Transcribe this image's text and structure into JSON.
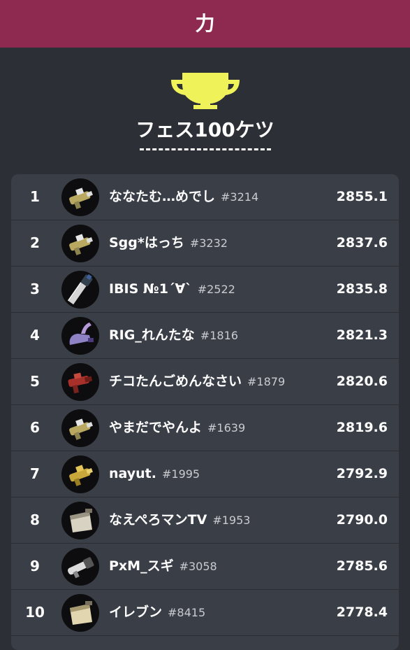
{
  "header": {
    "title": "力"
  },
  "trophy": {
    "icon": "trophy-icon",
    "color": "#f0f259"
  },
  "ranking": {
    "title": "フェス100ケツ",
    "rows": [
      {
        "rank": "1",
        "name": "ななたむ…めでし",
        "tag": "#3214",
        "power": "2855.1",
        "weapon_icon": "splattershot-weapon-icon"
      },
      {
        "rank": "2",
        "name": "Sgg*はっち",
        "tag": "#3232",
        "power": "2837.6",
        "weapon_icon": "splattershot-weapon-icon"
      },
      {
        "rank": "3",
        "name": "IBIS №1´∀`",
        "tag": "#2522",
        "power": "2835.8",
        "weapon_icon": "splatana-weapon-icon"
      },
      {
        "rank": "4",
        "name": "RIG_れんたな",
        "tag": "#1816",
        "power": "2821.3",
        "weapon_icon": "splatling-weapon-icon"
      },
      {
        "rank": "5",
        "name": "チコたんごめんなさい",
        "tag": "#1879",
        "power": "2820.6",
        "weapon_icon": "blaster-weapon-icon"
      },
      {
        "rank": "6",
        "name": "やまだでやんよ",
        "tag": "#1639",
        "power": "2819.6",
        "weapon_icon": "splattershot-weapon-icon"
      },
      {
        "rank": "7",
        "name": "nayut.",
        "tag": "#1995",
        "power": "2792.9",
        "weapon_icon": "splattershot-gold-weapon-icon"
      },
      {
        "rank": "8",
        "name": "なえぺろマンTV",
        "tag": "#1953",
        "power": "2790.0",
        "weapon_icon": "bucket-weapon-icon"
      },
      {
        "rank": "9",
        "name": "PxM_スギ",
        "tag": "#3058",
        "power": "2785.6",
        "weapon_icon": "splatana-weapon-icon"
      },
      {
        "rank": "10",
        "name": "イレブン",
        "tag": "#8415",
        "power": "2778.4",
        "weapon_icon": "bucket-weapon-icon"
      }
    ]
  },
  "colors": {
    "header_bg": "#8e2a50",
    "page_bg": "#2c2f36",
    "list_bg": "#3a3e47",
    "trophy": "#f0f259"
  }
}
